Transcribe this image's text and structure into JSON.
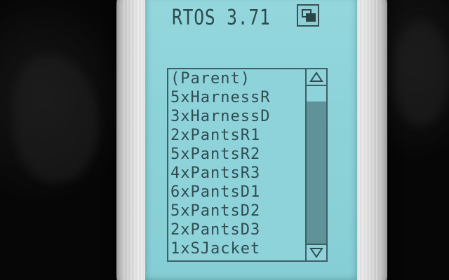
{
  "os": {
    "title": "RTOS 3.71",
    "window_icon": "window-restore-icon"
  },
  "list": {
    "items": [
      "(Parent)",
      "5xHarnessR",
      "3xHarnessD",
      "2xPantsR1",
      "5xPantsR2",
      "4xPantsR3",
      "6xPantsD1",
      "5xPantsD2",
      "2xPantsD3",
      "1xSJacket"
    ],
    "scroll_position_fraction": 0.1,
    "visible_fraction": 0.9
  },
  "scrollbar": {
    "up_icon": "triangle-up-icon",
    "down_icon": "triangle-down-icon"
  },
  "colors": {
    "screen": "#8cd3d9",
    "text": "#2f4c51",
    "thumb": "#5e9399"
  }
}
